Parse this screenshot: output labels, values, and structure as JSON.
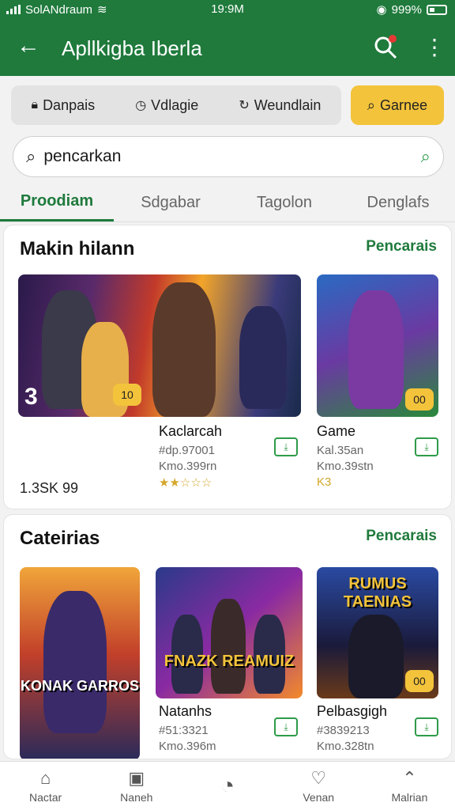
{
  "status": {
    "carrier": "SolANdraum",
    "time": "19:9M",
    "battery": "999%"
  },
  "appbar": {
    "title": "Apllkigba Iberla"
  },
  "filters": [
    {
      "label": "Danpais",
      "icon": "lock-icon"
    },
    {
      "label": "Vdlagie",
      "icon": "clock-icon"
    },
    {
      "label": "Weundlain",
      "icon": "refresh-icon"
    }
  ],
  "games_button": {
    "label": "Garnee"
  },
  "search": {
    "value": "pencarkan"
  },
  "tabs": [
    "Proodiam",
    "Sdgabar",
    "Tagolon",
    "Denglafs"
  ],
  "section1": {
    "title": "Makin hilann",
    "link": "Pencarais",
    "rank": "3",
    "badge_main": "10",
    "badge_side": "00",
    "count": "1.3SK 99",
    "items": [
      {
        "title": "Kaclarcah",
        "sub1": "#dp.97001",
        "sub2": "Kmo.399rn",
        "stars": "★★☆☆☆"
      },
      {
        "title": "Game",
        "sub1": "Kal.35an",
        "sub2": "Kmo.39stn",
        "stars": "K3"
      }
    ]
  },
  "section2": {
    "title": "Cateirias",
    "link": "Pencarais",
    "tile1_text": "KONAK GARROS",
    "tile2_text": "FNAZK REAMUIZ",
    "tile3_text": "RUMUS TAENIAS",
    "badge": "00",
    "items": [
      {
        "title": "Natanhs",
        "sub1": "#51:3321",
        "sub2": "Kmo.396m"
      },
      {
        "title": "Pelbasgigh",
        "sub1": "#3839213",
        "sub2": "Kmo.328tn"
      }
    ]
  },
  "bottomnav": [
    {
      "label": "Nactar",
      "icon": "home-icon"
    },
    {
      "label": "Naneh",
      "icon": "gift-icon"
    },
    {
      "label": "",
      "icon": "timer-icon"
    },
    {
      "label": "Venan",
      "icon": "heart-icon"
    },
    {
      "label": "Malrian",
      "icon": "up-icon"
    }
  ],
  "colors": {
    "primary": "#1f7a3c",
    "accent": "#f3c33b"
  }
}
